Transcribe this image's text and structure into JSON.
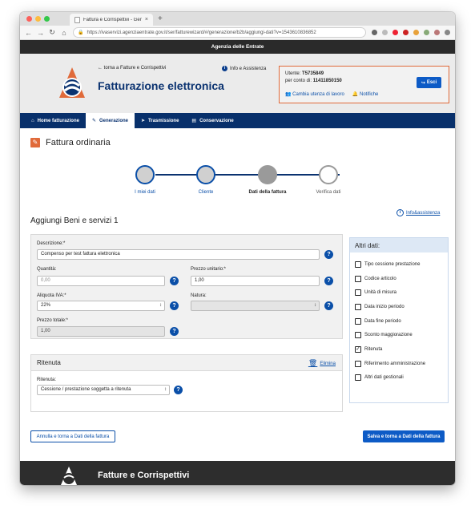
{
  "browser": {
    "tab_title": "Fattura e Corrispettivi - Genera...",
    "tab_close": "×",
    "new_tab": "+",
    "url": "https://ivaservizi.agenziaentrate.gov.it/ser/fatturewizard/#/generazione/b2b/aggiungi-dati?v=1543610836852",
    "colors": {
      "close": "#fc605b",
      "min": "#fdbc40",
      "max": "#34c84a"
    }
  },
  "agency": {
    "name": "Agenzia delle Entrate"
  },
  "header": {
    "back_link": "torna a Fatture e Corrispettivi",
    "info_link": "Info e Assistenza",
    "app_title": "Fatturazione elettronica"
  },
  "user": {
    "utente_label": "Utente:",
    "utente_value": "T5735849",
    "conto_label": "per conto di:",
    "conto_value": "11411850150",
    "change_user": "Cambia utenza di lavoro",
    "notifications": "Notifiche",
    "exit_button": "Esci"
  },
  "nav": {
    "items": [
      {
        "label": "Home fatturazione",
        "icon": "home-icon"
      },
      {
        "label": "Generazione",
        "icon": "pencil-icon",
        "active": true
      },
      {
        "label": "Trasmissione",
        "icon": "send-icon"
      },
      {
        "label": "Conservazione",
        "icon": "archive-icon"
      }
    ]
  },
  "page": {
    "section_title": "Fattura ordinaria",
    "add_title": "Aggiungi Beni e servizi 1",
    "info_assist": "Info&assistenza"
  },
  "stepper": {
    "steps": [
      {
        "label": "I miei dati",
        "state": "done"
      },
      {
        "label": "Cliente",
        "state": "done"
      },
      {
        "label": "Dati della fattura",
        "state": "current"
      },
      {
        "label": "Verifica dati",
        "state": "todo"
      }
    ]
  },
  "form": {
    "descrizione_label": "Descrizione:*",
    "descrizione_value": "Compenso per test fattura elettronica",
    "quantita_label": "Quantità:",
    "quantita_value": "0,00",
    "prezzo_unitario_label": "Prezzo unitario:*",
    "prezzo_unitario_value": "1,00",
    "aliquota_label": "Aliquota IVA:*",
    "aliquota_value": "22%",
    "natura_label": "Natura:",
    "natura_value": "",
    "prezzo_totale_label": "Prezzo totale:*",
    "prezzo_totale_value": "1,00",
    "help": "?"
  },
  "ritenuta": {
    "title": "Ritenuta",
    "delete": "Elimina",
    "field_label": "Ritenuta:",
    "field_value": "Cessione / prestazione soggetta a ritenuta"
  },
  "altri_dati": {
    "title": "Altri dati:",
    "items": [
      {
        "label": "Tipo cessione prestazione",
        "checked": false
      },
      {
        "label": "Codice articolo",
        "checked": false
      },
      {
        "label": "Unità di misura",
        "checked": false
      },
      {
        "label": "Data inizio periodo",
        "checked": false
      },
      {
        "label": "Data fine periodo",
        "checked": false
      },
      {
        "label": "Sconto maggiorazione",
        "checked": false
      },
      {
        "label": "Ritenuta",
        "checked": true
      },
      {
        "label": "Riferimento amministrazione",
        "checked": false
      },
      {
        "label": "Altri dati gestionali",
        "checked": false
      }
    ]
  },
  "buttons": {
    "cancel": "Annulla e torna a Dati della fattura",
    "save": "Salva e torna a Dati della fattura"
  },
  "footer": {
    "title": "Fatture e Corrispettivi"
  },
  "colors": {
    "navy": "#08306b",
    "accent": "#e06a3a",
    "link": "#0a4fa8",
    "button": "#0d5bc6"
  }
}
